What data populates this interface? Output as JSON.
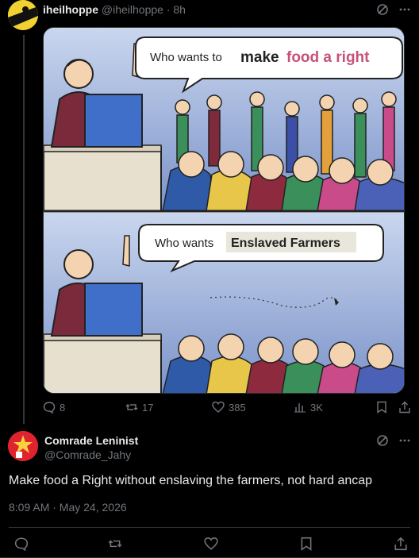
{
  "post": {
    "display_name": "iheilhoppe",
    "handle": "@iheilhoppe",
    "separator": "·",
    "time": "8h",
    "more_icon": "more-dots-icon",
    "grok_icon": "grok-icon",
    "media": {
      "panel1": {
        "bubble_prefix": "Who wants to",
        "bubble_emph1": "make",
        "bubble_emph2": "food a right"
      },
      "panel2": {
        "bubble_prefix": "Who wants",
        "bubble_box": "Enslaved Farmers"
      }
    },
    "actions": {
      "replies": "8",
      "reposts": "17",
      "likes": "385",
      "views": "3K"
    }
  },
  "reply": {
    "display_name": "Comrade Leninist",
    "handle": "@Comrade_Jahy",
    "text": "Make food a Right without enslaving the farmers, not hard ancap",
    "meta": "8:09 AM · May 24, 2026"
  },
  "colors": {
    "background": "#000000",
    "text": "#e7e9ea",
    "muted": "#71767b",
    "border": "#2f3336",
    "emph_pink": "#c4527a"
  }
}
